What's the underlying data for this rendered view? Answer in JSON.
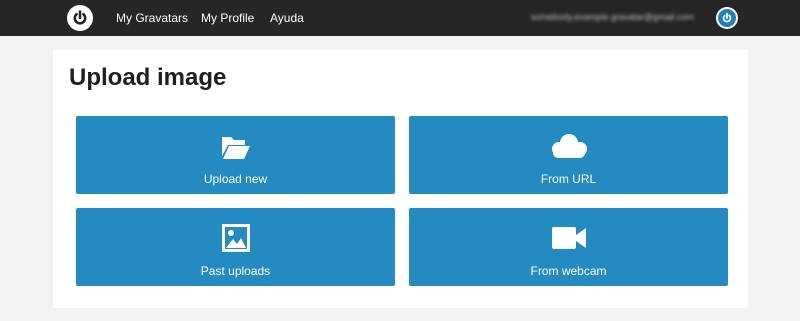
{
  "nav": {
    "logo_icon": "gravatar-logo-icon",
    "links": [
      "My Gravatars",
      "My Profile",
      "Ayuda"
    ],
    "email": "somebody.example.gravatar@gmail.com",
    "avatar_icon": "gravatar-logo-icon"
  },
  "page": {
    "title": "Upload image"
  },
  "options": [
    {
      "label": "Upload new",
      "icon": "folder-open-icon"
    },
    {
      "label": "From URL",
      "icon": "cloud-icon"
    },
    {
      "label": "Past uploads",
      "icon": "image-icon"
    },
    {
      "label": "From webcam",
      "icon": "video-camera-icon"
    }
  ],
  "colors": {
    "topbar": "#262626",
    "tile": "#248ac2",
    "background": "#f3f3f3",
    "accent": "#1e7fc0"
  }
}
